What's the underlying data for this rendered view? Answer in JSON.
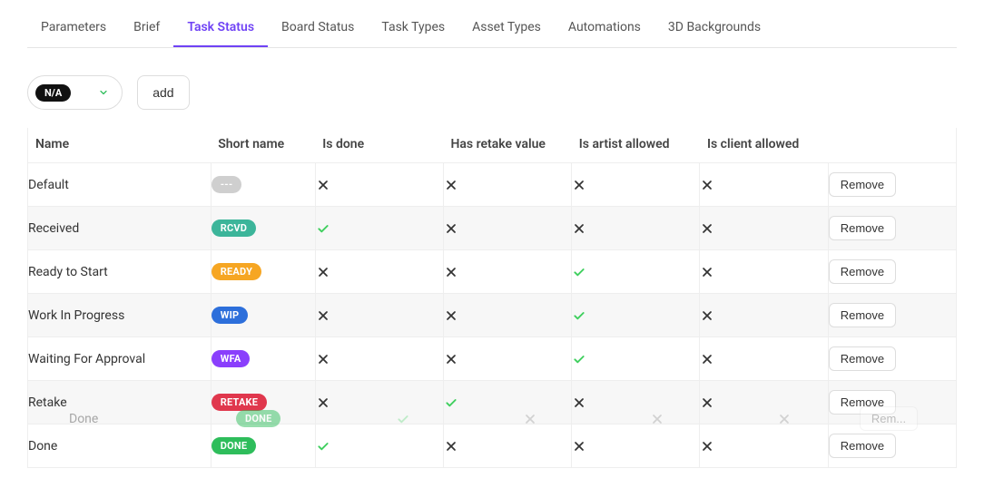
{
  "tabs": [
    {
      "label": "Parameters",
      "active": false
    },
    {
      "label": "Brief",
      "active": false
    },
    {
      "label": "Task Status",
      "active": true
    },
    {
      "label": "Board Status",
      "active": false
    },
    {
      "label": "Task Types",
      "active": false
    },
    {
      "label": "Asset Types",
      "active": false
    },
    {
      "label": "Automations",
      "active": false
    },
    {
      "label": "3D Backgrounds",
      "active": false
    }
  ],
  "toolbar": {
    "select_value": "N/A",
    "add_label": "add"
  },
  "columns": {
    "name": "Name",
    "short": "Short name",
    "done": "Is done",
    "retake": "Has retake value",
    "artist": "Is artist allowed",
    "client": "Is client allowed"
  },
  "remove_label": "Remove",
  "colors": {
    "grey": "#cfcfcf",
    "teal": "#3cb59a",
    "orange": "#f6a623",
    "blue": "#2d6fdb",
    "purple": "#8a3ffc",
    "red": "#e0374d",
    "green": "#2ebd5b",
    "check": "#3fcf5e",
    "cross": "#333333"
  },
  "rows": [
    {
      "name": "Default",
      "short": "---",
      "color": "grey",
      "done": false,
      "retake": false,
      "artist": false,
      "client": false
    },
    {
      "name": "Received",
      "short": "RCVD",
      "color": "teal",
      "done": true,
      "retake": false,
      "artist": false,
      "client": false
    },
    {
      "name": "Ready to Start",
      "short": "READY",
      "color": "orange",
      "done": false,
      "retake": false,
      "artist": true,
      "client": false
    },
    {
      "name": "Work In Progress",
      "short": "WIP",
      "color": "blue",
      "done": false,
      "retake": false,
      "artist": true,
      "client": false
    },
    {
      "name": "Waiting For Approval",
      "short": "WFA",
      "color": "purple",
      "done": false,
      "retake": false,
      "artist": true,
      "client": false
    },
    {
      "name": "Retake",
      "short": "RETAKE",
      "color": "red",
      "done": false,
      "retake": true,
      "artist": false,
      "client": false
    },
    {
      "name": "Done",
      "short": "DONE",
      "color": "green",
      "done": true,
      "retake": false,
      "artist": false,
      "client": false
    }
  ],
  "ghost_row": {
    "over_index": 5,
    "name": "Done",
    "short": "DONE",
    "color": "green",
    "done": true,
    "retake": false,
    "artist": false,
    "client": false,
    "remove_label": "Rem..."
  }
}
